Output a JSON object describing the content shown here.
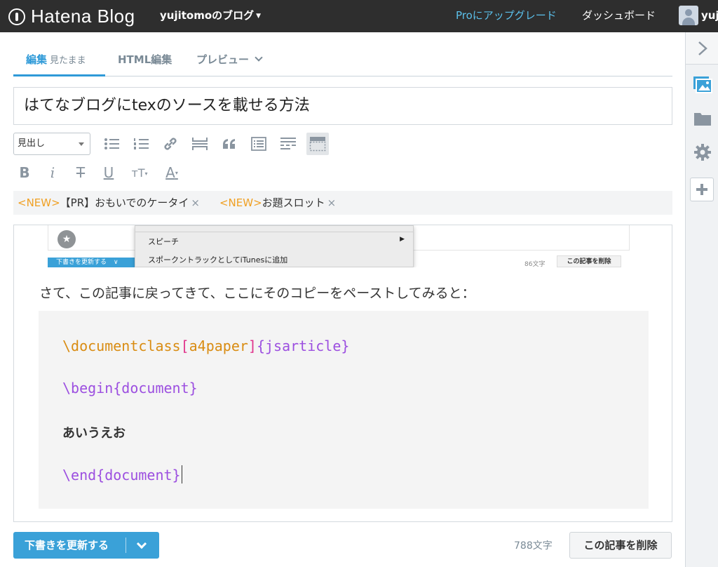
{
  "topbar": {
    "logo_text": "Hatena Blog",
    "blog_name": "yujitomoのブログ",
    "upgrade": "Proにアップグレード",
    "dashboard": "ダッシュボード",
    "user": "yuji"
  },
  "tabs": {
    "edit": "編集",
    "edit_mode": "見たまま",
    "html": "HTML編集",
    "preview": "プレビュー"
  },
  "post": {
    "title": "はてなブログにtexのソースを載せる方法"
  },
  "toolbar": {
    "format_select": "見出し"
  },
  "notices": [
    {
      "tag": "<NEW>",
      "text": "【PR】おもいでのケータイ",
      "close": "×"
    },
    {
      "tag": "<NEW>",
      "text": "お題スロット",
      "close": "×"
    }
  ],
  "embedded_screenshot": {
    "menu_item_1": "スピーチ",
    "menu_item_2": "スポークントラックとしてiTunesに追加",
    "save_label": "下書きを更新する",
    "count": "86文字",
    "delete_label": "この記事を削除"
  },
  "content": {
    "paragraph": "さて、この記事に戻ってきて、ここにそのコピーをペーストしてみると：",
    "code": {
      "line1_cmd": "\\documentclass",
      "line1_ob": "[",
      "line1_opt": "a4paper",
      "line1_cb": "]",
      "line1_arg": "{jsarticle}",
      "line2_cmd": "\\begin",
      "line2_arg": "{document}",
      "line3": "あいうえお",
      "line4_cmd": "\\end",
      "line4_arg": "{document}"
    }
  },
  "footer": {
    "save_button": "下書きを更新する",
    "char_count": "788文字",
    "delete_button": "この記事を削除"
  },
  "colors": {
    "accent": "#3aa1d8",
    "topbar": "#2e2e2e",
    "new_tag": "#f0a023",
    "code_command": "#d98c12",
    "code_keyword": "#9c4fe0",
    "code_bracket": "#e0348c"
  }
}
